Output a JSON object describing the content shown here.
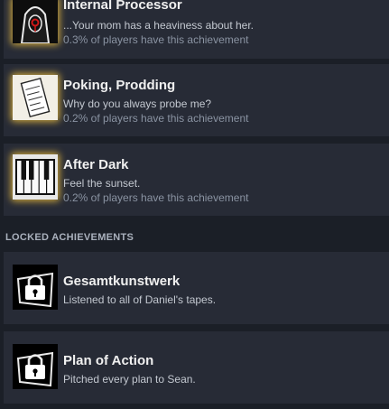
{
  "unlocked": [
    {
      "title": "Internal Processor",
      "description": "...Your mom has a heaviness about her.",
      "percent": "0.3% of players have this achievement",
      "icon": "hooded-figure-icon"
    },
    {
      "title": "Poking, Prodding",
      "description": "Why do you always probe me?",
      "percent": "0.2% of players have this achievement",
      "icon": "note-paper-icon"
    },
    {
      "title": "After Dark",
      "description": "Feel the sunset.",
      "percent": "0.2% of players have this achievement",
      "icon": "piano-keys-icon"
    }
  ],
  "locked_header": "LOCKED ACHIEVEMENTS",
  "locked": [
    {
      "title": "Gesamtkunstwerk",
      "description": "Listened to all of Daniel's tapes.",
      "icon": "padlock-icon"
    },
    {
      "title": "Plan of Action",
      "description": "Pitched every plan to Sean.",
      "icon": "padlock-icon"
    }
  ],
  "colors": {
    "background": "#1b1f27",
    "row_background": "#272b36",
    "glow": "#ffcc40"
  }
}
